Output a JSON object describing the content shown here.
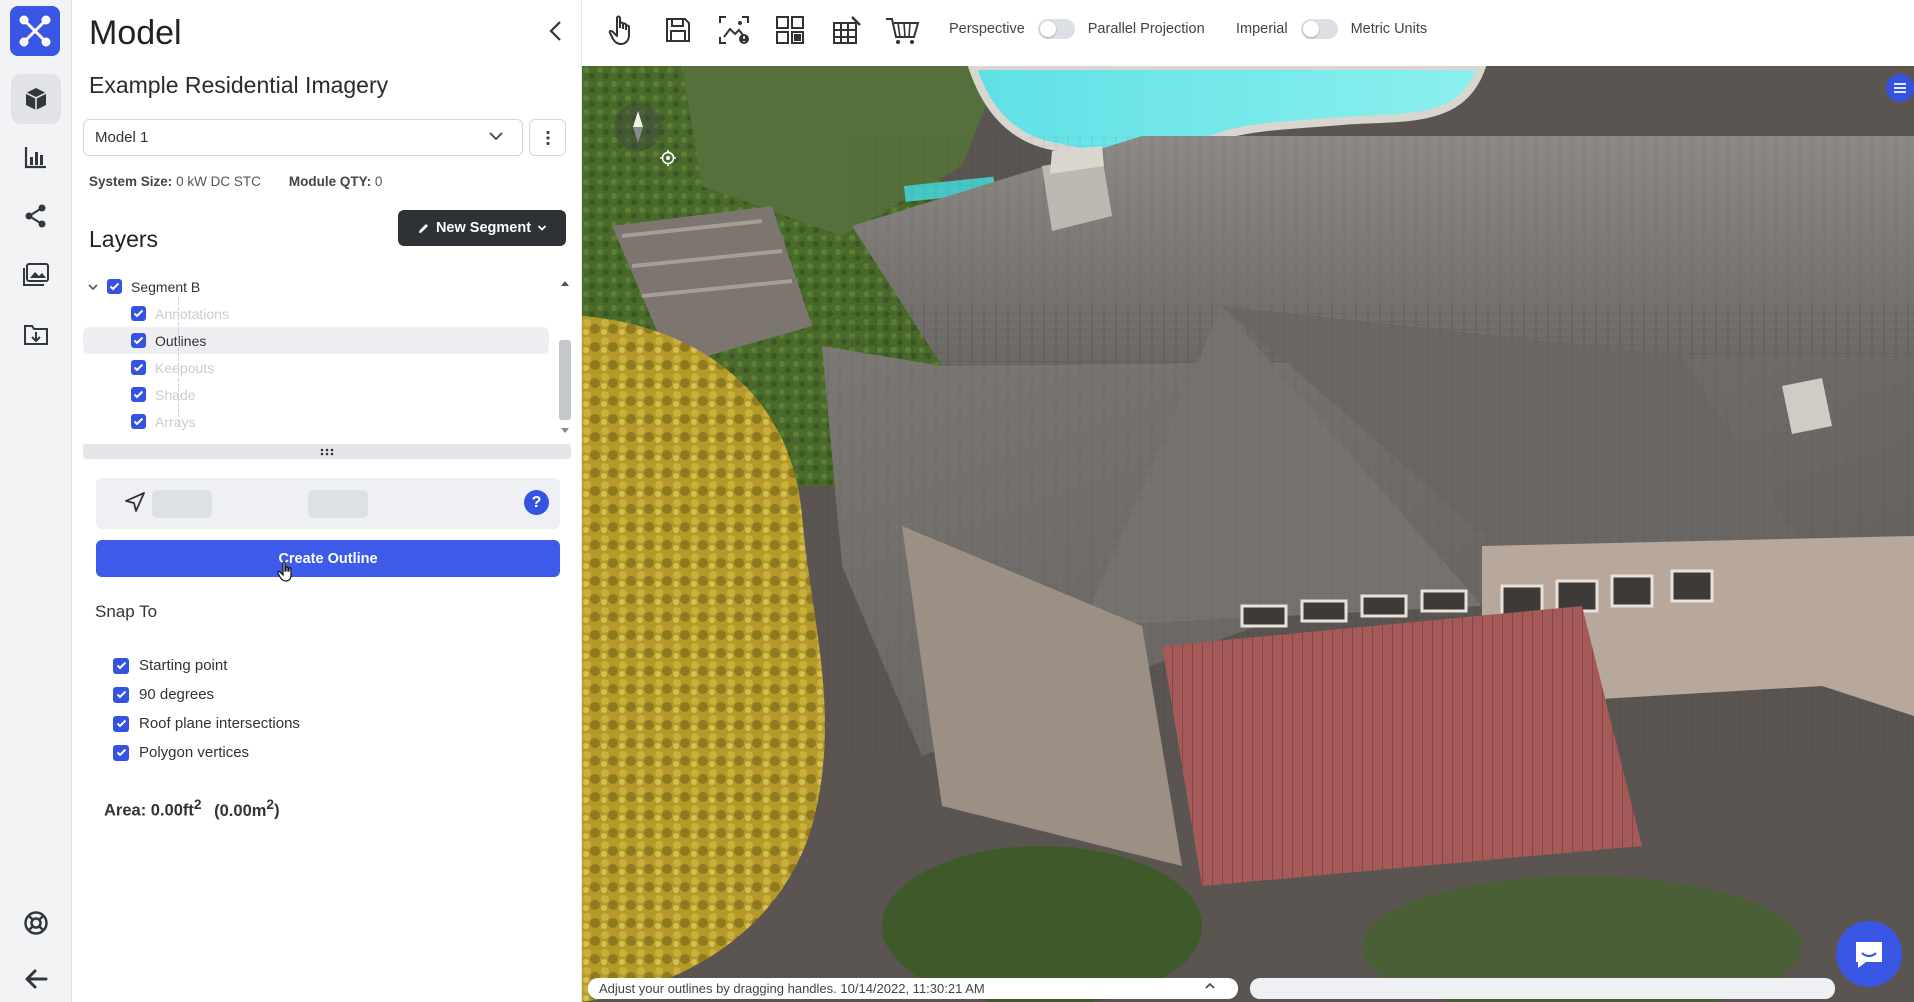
{
  "panel": {
    "title": "Model",
    "project_name": "Example Residential Imagery",
    "model_select_value": "Model 1",
    "system_size_label": "System Size:",
    "system_size_value": "0 kW DC STC",
    "module_qty_label": "Module QTY:",
    "module_qty_value": "0",
    "layers_title": "Layers",
    "new_segment_label": "New Segment",
    "tree": {
      "segment": "Segment B",
      "children": [
        "Annotations",
        "Outlines",
        "Keepouts",
        "Shade",
        "Arrays"
      ],
      "selected": "Outlines"
    },
    "create_outline_label": "Create Outline",
    "help_label": "?",
    "snap_title": "Snap To",
    "snap_items": [
      "Starting point",
      "90 degrees",
      "Roof plane intersections",
      "Polygon vertices"
    ],
    "area_label": "Area:",
    "area_ft": "0.00ft",
    "area_ft_sup": "2",
    "area_m": "(0.00m",
    "area_m_sup": "2",
    "area_m_close": ")"
  },
  "toolbar": {
    "perspective_label": "Perspective",
    "parallel_label": "Parallel Projection",
    "imperial_label": "Imperial",
    "metric_label": "Metric Units"
  },
  "status": {
    "message": "Adjust your outlines by dragging handles.",
    "timestamp": "10/14/2022, 11:30:21 AM"
  },
  "colors": {
    "accent": "#3d5ae8",
    "dark_button": "#2e3236",
    "rail_bg": "#f2f3f5"
  },
  "icons": {
    "rail": [
      "app-logo-icon",
      "model-cube-icon",
      "bar-chart-icon",
      "share-icon",
      "imagery-icon",
      "download-icon",
      "support-lifebuoy-icon",
      "back-arrow-icon"
    ],
    "toolbar": [
      "hand-pointer-icon",
      "save-icon",
      "image-edit-icon",
      "grid-layout-icon",
      "module-grid-icon",
      "cart-shape-icon"
    ]
  }
}
